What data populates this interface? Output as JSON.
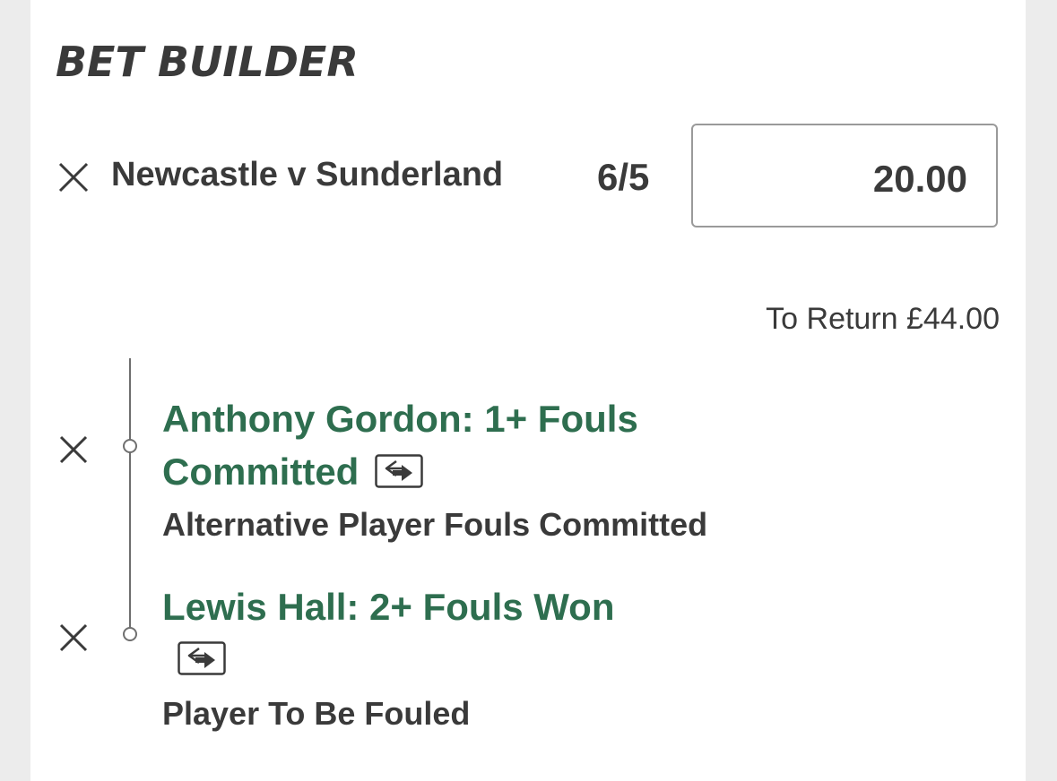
{
  "bet_builder": {
    "title": "BET BUILDER",
    "match": "Newcastle v Sunderland",
    "odds": "6/5",
    "stake": "20.00",
    "to_return": "To Return £44.00",
    "selections": [
      {
        "title_line1": "Anthony Gordon: 1+ Fouls",
        "title_line2": "Committed",
        "market": "Alternative Player Fouls Committed"
      },
      {
        "title_line1": "Lewis Hall: 2+ Fouls Won",
        "market": "Player To Be Fouled"
      }
    ]
  },
  "icons": {
    "remove": "close-icon",
    "swap": "swap-icon"
  },
  "colors": {
    "selection_green": "#2e6e4f",
    "text_dark": "#3a3a3a",
    "border_grey": "#9a9a9a"
  }
}
